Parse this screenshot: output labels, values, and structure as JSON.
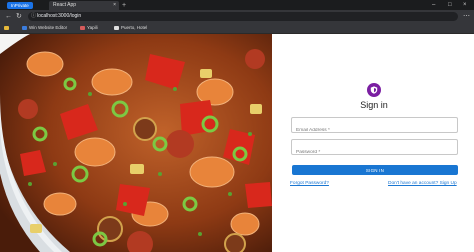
{
  "browser": {
    "profile_tab": "InPrivate",
    "tab_title": "React App",
    "tab_close": "×",
    "new_tab": "+",
    "address": "localhost:3000/login",
    "bookmarks": [
      "Win Website Editor",
      "Yapili",
      "Puerto, Hotel"
    ]
  },
  "login": {
    "title": "Sign in",
    "email_placeholder": "Email Address *",
    "password_placeholder": "Password *",
    "button_label": "SIGN IN",
    "forgot_link": "Forgot Password?",
    "signup_link": "Don't have an account? Sign Up"
  },
  "colors": {
    "accent": "#1976d2",
    "avatar": "#7b1fa2"
  }
}
